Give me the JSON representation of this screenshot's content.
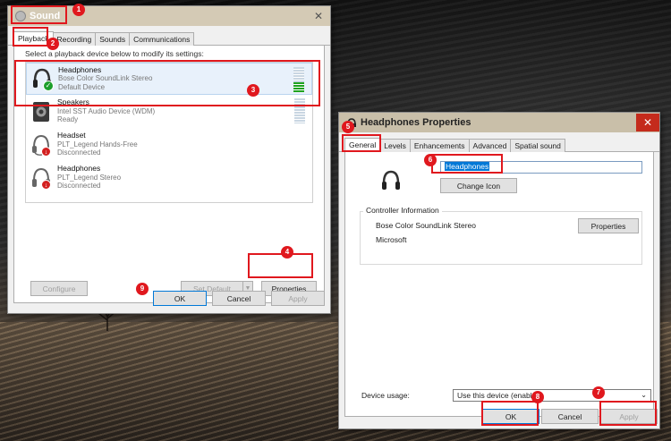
{
  "sound": {
    "title": "Sound",
    "tabs": [
      "Playback",
      "Recording",
      "Sounds",
      "Communications"
    ],
    "hint": "Select a playback device below to modify its settings:",
    "devices": [
      {
        "name": "Headphones",
        "sub1": "Bose Color SoundLink Stereo",
        "sub2": "Default Device"
      },
      {
        "name": "Speakers",
        "sub1": "Intel SST Audio Device (WDM)",
        "sub2": "Ready"
      },
      {
        "name": "Headset",
        "sub1": "PLT_Legend Hands-Free",
        "sub2": "Disconnected"
      },
      {
        "name": "Headphones",
        "sub1": "PLT_Legend Stereo",
        "sub2": "Disconnected"
      }
    ],
    "meter_level": 0.4,
    "configure": "Configure",
    "set_default": "Set Default",
    "properties": "Properties",
    "ok": "OK",
    "cancel": "Cancel",
    "apply": "Apply"
  },
  "props": {
    "title": "Headphones Properties",
    "tabs": [
      "General",
      "Levels",
      "Enhancements",
      "Advanced",
      "Spatial sound"
    ],
    "name_value": "Headphones",
    "change_icon": "Change Icon",
    "controller_title": "Controller Information",
    "controller_name": "Bose Color SoundLink Stereo",
    "controller_vendor": "Microsoft",
    "properties": "Properties",
    "device_usage_label": "Device usage:",
    "device_usage_value": "Use this device (enable)",
    "ok": "OK",
    "cancel": "Cancel",
    "apply": "Apply"
  },
  "annotations": [
    "1",
    "2",
    "3",
    "4",
    "5",
    "6",
    "7",
    "8",
    "9"
  ],
  "colors": {
    "annotation": "#e0181e",
    "accent": "#0078d7"
  },
  "close_glyph": "✕"
}
